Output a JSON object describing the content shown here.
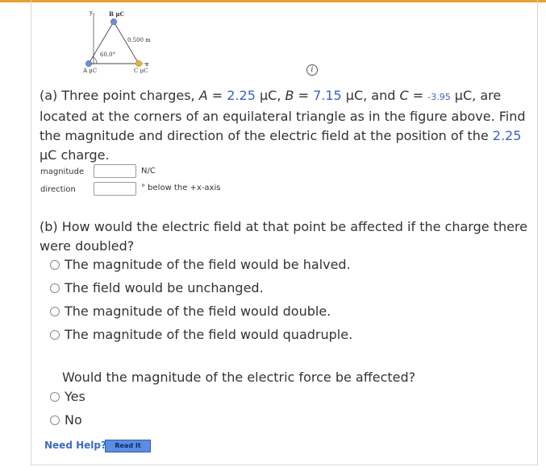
{
  "figure": {
    "label_b": "B μC",
    "label_a": "A μC",
    "label_c": "C μC",
    "label_side": "0.500 m",
    "label_angle": "60.0°",
    "label_y": "y",
    "label_x": "x",
    "colors": {
      "charge_a": "#6d8fd8",
      "charge_b": "#6d8fd8",
      "charge_c": "#e8b430"
    }
  },
  "info_icon": "i",
  "part_a": {
    "intro": "(a) Three point charges, ",
    "a_label": "A",
    "eq1": " = ",
    "a_value": "2.25",
    "unit1": " μC, ",
    "b_label": "B",
    "eq2": " = ",
    "b_value": "7.15",
    "unit2": " μC, and ",
    "c_label": "C",
    "eq3": " = ",
    "c_value": "-3.95",
    "unit3": " μC, are located at the corners of an equilateral triangle as in the figure above. Find the magnitude and direction of the electric field at the position of the ",
    "target_value": "2.25",
    "tail": " μC charge.",
    "magnitude_label": "magnitude",
    "magnitude_unit": "N/C",
    "direction_label": "direction",
    "direction_unit": "° below the +x-axis"
  },
  "part_b": {
    "question": "(b) How would the electric field at that point be affected if the charge there were doubled?",
    "options": [
      "The magnitude of the field would be halved.",
      "The field would be unchanged.",
      "The magnitude of the field would double.",
      "The magnitude of the field would quadruple."
    ]
  },
  "part_c": {
    "question": "Would the magnitude of the electric force be affected?",
    "options": [
      "Yes",
      "No"
    ]
  },
  "help": {
    "label": "Need Help?",
    "button": "Read It"
  }
}
